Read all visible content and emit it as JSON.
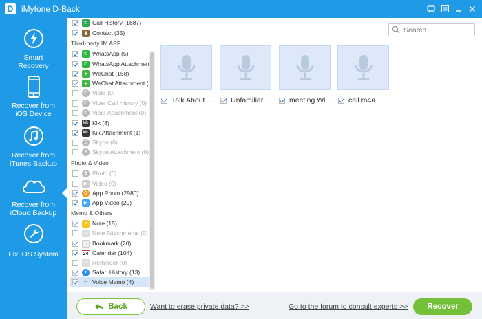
{
  "window": {
    "title": "iMyfone D-Back",
    "logo_letter": "D"
  },
  "nav": [
    {
      "label": "Smart Recovery",
      "icon": "lightning-icon"
    },
    {
      "label": "Recover from iOS Device",
      "icon": "phone-icon"
    },
    {
      "label": "Recover from iTunes Backup",
      "icon": "music-note-icon"
    },
    {
      "label": "Recover from iCloud Backup",
      "icon": "cloud-icon",
      "active": true
    },
    {
      "label": "Fix iOS System",
      "icon": "wrench-icon"
    }
  ],
  "tree": {
    "items": [
      {
        "label": "Call History (1687)",
        "checked": true,
        "icon_color": "#2da94f"
      },
      {
        "label": "Contact (35)",
        "checked": true,
        "icon_color": "#8a6a3c"
      }
    ],
    "sections": [
      {
        "title": "Third-party IM APP",
        "items": [
          {
            "label": "WhatsApp (5)",
            "checked": true,
            "icon_color": "#2cb742"
          },
          {
            "label": "WhatsApp Attachmen...",
            "checked": true,
            "icon_color": "#2cb742"
          },
          {
            "label": "WeChat (158)",
            "checked": true,
            "icon_color": "#44b549"
          },
          {
            "label": "WeChat Attachment (3...",
            "checked": true,
            "icon_color": "#44b549"
          },
          {
            "label": "Viber (0)",
            "checked": false,
            "disabled": true,
            "icon_color": "#b8b8b8"
          },
          {
            "label": "Viber Call History (0)",
            "checked": false,
            "disabled": true,
            "icon_color": "#b8b8b8"
          },
          {
            "label": "Viber Attachment (0)",
            "checked": false,
            "disabled": true,
            "icon_color": "#b8b8b8"
          },
          {
            "label": "Kik (8)",
            "checked": true,
            "icon_color": "#3a3a3a"
          },
          {
            "label": "Kik Attachment (1)",
            "checked": true,
            "icon_color": "#3a3a3a"
          },
          {
            "label": "Skype (0)",
            "checked": false,
            "disabled": true,
            "icon_color": "#b8b8b8"
          },
          {
            "label": "Skype Attachment (0)",
            "checked": false,
            "disabled": true,
            "icon_color": "#b8b8b8"
          }
        ]
      },
      {
        "title": "Photo & Video",
        "items": [
          {
            "label": "Photo (0)",
            "checked": false,
            "disabled": true,
            "icon_color": "#b8b8b8"
          },
          {
            "label": "Video (0)",
            "checked": false,
            "disabled": true,
            "icon_color": "#cccccc"
          },
          {
            "label": "App Photo (2980)",
            "checked": true,
            "icon_color": "#f09a2a"
          },
          {
            "label": "App Video (29)",
            "checked": true,
            "icon_color": "#3fa9f5"
          }
        ]
      },
      {
        "title": "Memo & Others",
        "items": [
          {
            "label": "Note (15)",
            "checked": true,
            "icon_color": "#f3c623"
          },
          {
            "label": "Note Attachments (0)",
            "checked": false,
            "disabled": true,
            "icon_color": "#dddddd"
          },
          {
            "label": "Bookmark (20)",
            "checked": true,
            "icon_color": "#eeeeee"
          },
          {
            "label": "Calendar (104)",
            "checked": true,
            "icon_color": "#ffffff",
            "glyph": "24"
          },
          {
            "label": "Reminder (0)",
            "checked": false,
            "disabled": true,
            "icon_color": "#dddddd"
          },
          {
            "label": "Safari History (13)",
            "checked": true,
            "icon_color": "#2b8fe6"
          },
          {
            "label": "Voice Memo (4)",
            "checked": true,
            "icon_color": "#9ab",
            "selected": true
          }
        ]
      }
    ]
  },
  "search": {
    "placeholder": "Search"
  },
  "files": [
    {
      "name": "Talk About ...",
      "checked": true
    },
    {
      "name": "Unfamiliar ...",
      "checked": true
    },
    {
      "name": "meeting Wi...",
      "checked": true
    },
    {
      "name": "call.m4a",
      "checked": true
    }
  ],
  "bottom": {
    "back_label": "Back",
    "erase_link": "Want to erase private data? >>",
    "forum_link": "Go to the forum to consult experts >>",
    "recover_label": "Recover"
  },
  "colors": {
    "accent": "#1e9ae6",
    "green": "#74c03a",
    "tile": "#dde9f8"
  }
}
